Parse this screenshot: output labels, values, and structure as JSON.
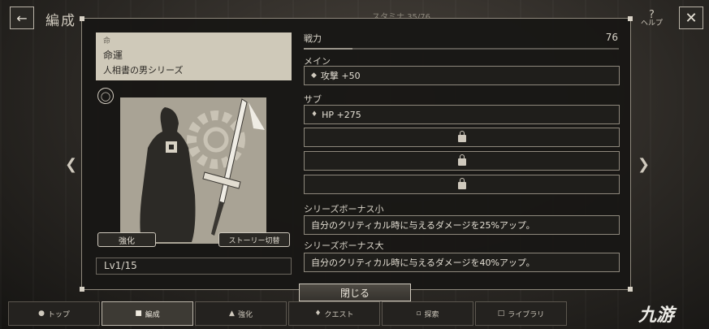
{
  "header": {
    "back_icon": "arrow-left-icon",
    "title": "編成",
    "stamina": "スタミナ 35/76",
    "help_label": "ヘルプ",
    "help_symbol": "?"
  },
  "card": {
    "symbol": "命",
    "name": "命運",
    "series": "人相書の男シリーズ"
  },
  "buttons": {
    "enhance": "強化",
    "story": "ストーリー切替",
    "close": "閉じる"
  },
  "level": "Lv1/15",
  "stats": {
    "power_label": "戦力",
    "power_value": "76",
    "main_label": "メイン",
    "main_value": "攻撃 +50",
    "sub_label": "サブ",
    "sub_value": "HP +275",
    "locked_slots": 3
  },
  "bonus": {
    "small_label": "シリーズボーナス小",
    "small_text": "自分のクリティカル時に与えるダメージを25%アップ。",
    "large_label": "シリーズボーナス大",
    "large_text": "自分のクリティカル時に与えるダメージを40%アップ。"
  },
  "nav": {
    "top": "トップ",
    "formation": "編成",
    "enhance": "強化",
    "quest": "クエスト",
    "explore": "探索",
    "library": "ライブラリ"
  },
  "watermark": "九游"
}
